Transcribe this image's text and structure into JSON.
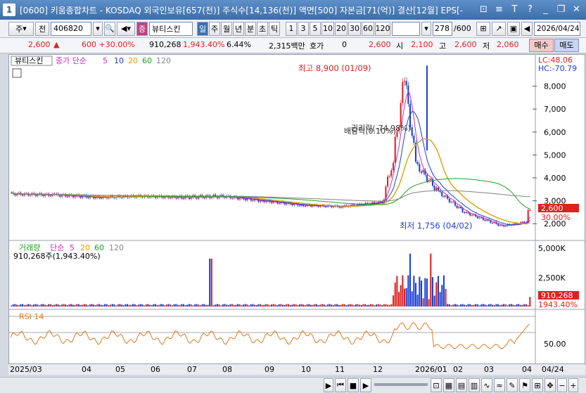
{
  "window": {
    "number": "1",
    "title": "[0600] 키움종합차트 - KOSDAQ 외국인보유[657(천)] 주식수[14,136(천)] 액면[500] 자본금[71(억)] 결산[12월] EPS[-"
  },
  "toolbar": {
    "type_label": "주",
    "prev_label": "전",
    "code": "406820",
    "stock_badge": "증",
    "stock_name": "뷰티스킨",
    "periods": [
      "일",
      "주",
      "월",
      "년",
      "분",
      "초",
      "틱"
    ],
    "selected_period": "일",
    "intervals": [
      "1",
      "3",
      "5",
      "10",
      "20",
      "30",
      "60",
      "120"
    ],
    "count": "278",
    "count_total": "/600",
    "date": "2026/04/24"
  },
  "price_bar": {
    "price": "2,600",
    "change": "600 +30.00%",
    "volume": "910,268",
    "volume_pct": "1,943.40%",
    "turnover": "6.44%",
    "amount": "2,315백만",
    "quote_label": "호가",
    "quote_value": "0",
    "open_value": "2,600",
    "open_label": "시",
    "open_price": "2,100",
    "high_label": "고",
    "high_price": "2,600",
    "low_label": "저",
    "low_price": "2,060",
    "buy_label": "매수",
    "sell_label": "매도"
  },
  "price_panel": {
    "legend_name": "뷰티스킨",
    "legend_ma": "종가 단순",
    "ma_periods": [
      "5",
      "10",
      "20",
      "60",
      "120"
    ],
    "lc_label": "LC:48.06",
    "hc_label": "HC:-70.79",
    "y_ticks": [
      "8,000",
      "7,000",
      "6,000",
      "5,000",
      "4,000",
      "3,000",
      "2,000"
    ],
    "high_annotation": "최고 8,900 (01/09)",
    "low_annotation": "최저 1,756 (04/02)",
    "event1": "권리락(-74.98%)",
    "event2": "배당락(0.10%)",
    "current_price_tag": "2,600",
    "current_pct_tag": "30.00%"
  },
  "volume_panel": {
    "legend_name": "거래량",
    "legend_ma": "단순",
    "ma_periods": [
      "5",
      "20",
      "60",
      "120"
    ],
    "value_label": "910,268주(1,943.40%)",
    "y_ticks": [
      "5,000K",
      "2,500K"
    ],
    "current_tag": "910,268",
    "current_pct_tag": "1943.40%"
  },
  "rsi_panel": {
    "legend": "RSI 14",
    "y_tick": "50.00"
  },
  "x_axis": {
    "labels": [
      "2025/03",
      "04",
      "05",
      "06",
      "07",
      "08",
      "09",
      "10",
      "11",
      "12",
      "2026/01",
      "02",
      "03",
      "04"
    ],
    "end_label": "04/24"
  },
  "colors": {
    "up": "#e02020",
    "down": "#1a3fd6",
    "ma5": "#c030c0",
    "ma10": "#1a3fd6",
    "ma20": "#e0a000",
    "ma60": "#20a020",
    "ma120": "#808080",
    "rsi": "#e07a20"
  },
  "chart_data": {
    "type": "line",
    "title": "뷰티스킨",
    "period": "daily",
    "x": [
      "2025/03",
      "2025/04",
      "2025/05",
      "2025/06",
      "2025/07",
      "2025/08",
      "2025/09",
      "2025/10",
      "2025/11",
      "2025/12",
      "2026/01",
      "2026/02",
      "2026/03",
      "2026/04",
      "04/24"
    ],
    "series": [
      {
        "name": "종가",
        "values": [
          3300,
          3250,
          3150,
          3200,
          3150,
          3200,
          3000,
          2800,
          2750,
          2950,
          5200,
          2700,
          2300,
          1900,
          2600
        ]
      }
    ],
    "ylim": [
      1700,
      9000
    ],
    "annotations": [
      {
        "label": "최고 8,900 (01/09)",
        "value": 8900
      },
      {
        "label": "최저 1,756 (04/02)",
        "value": 1756
      }
    ],
    "volume": {
      "max_label": "5,000K",
      "last": 910268
    },
    "rsi": {
      "mid": 50
    }
  }
}
